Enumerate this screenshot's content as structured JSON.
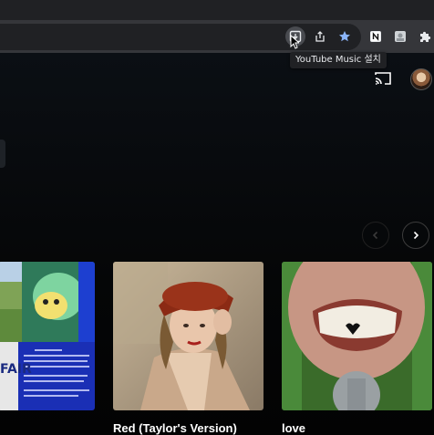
{
  "browser": {
    "tooltip": "YouTube Music 설치",
    "icons": [
      "install-app-icon",
      "share-icon",
      "bookmark-star-icon",
      "notion-icon",
      "extension-photo-icon",
      "extensions-puzzle-icon"
    ]
  },
  "header": {
    "icons": [
      "cast-icon",
      "avatar"
    ]
  },
  "carousel": {
    "nav": [
      "chevron-left-icon",
      "chevron-right-icon"
    ],
    "items": [
      {
        "title": ""
      },
      {
        "title": "Red (Taylor's Version)"
      },
      {
        "title": "love"
      }
    ],
    "collage_text": "FAIR"
  },
  "colors": {
    "accent_star": "#8ab4f8",
    "page_bg": "#030303",
    "toolbar_bg": "#35363a"
  }
}
